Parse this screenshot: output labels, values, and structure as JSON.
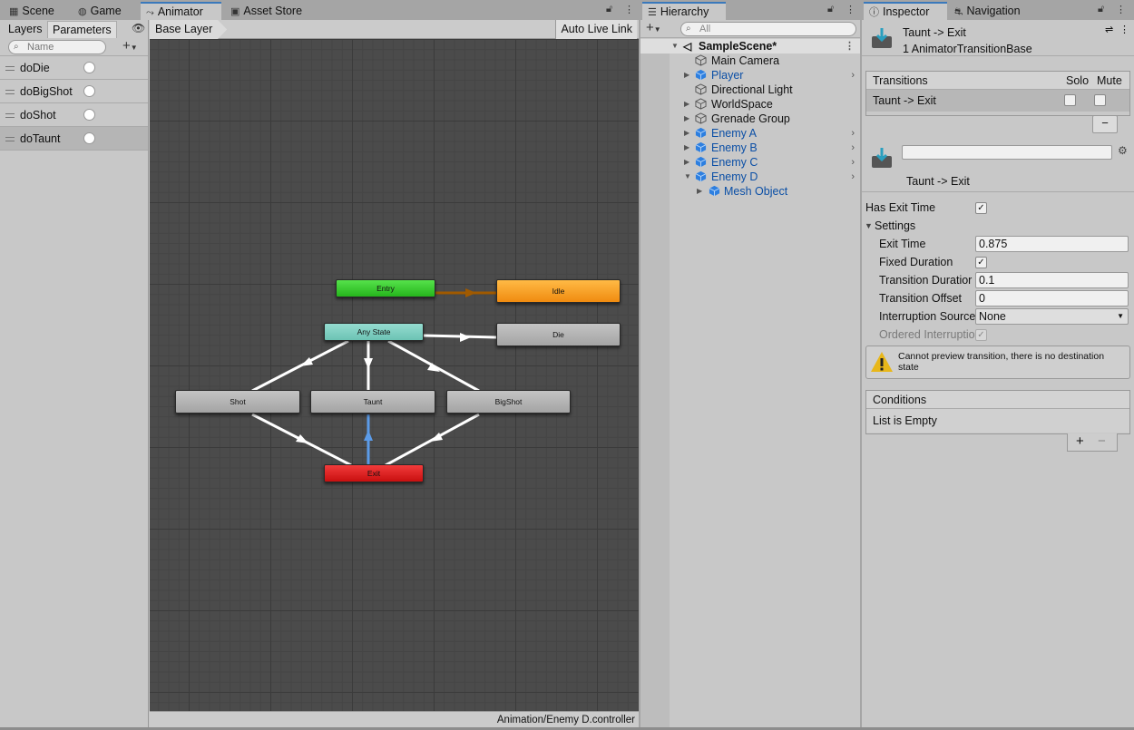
{
  "animator_panel": {
    "tabs": [
      {
        "label": "Scene",
        "icon": "grid-icon"
      },
      {
        "label": "Game",
        "icon": "gamepad-icon"
      },
      {
        "label": "Animator",
        "icon": "animator-icon"
      },
      {
        "label": "Asset Store",
        "icon": "store-icon"
      }
    ],
    "subtabs": {
      "layers": "Layers",
      "parameters": "Parameters"
    },
    "search_placeholder": "Name",
    "parameters": [
      "doDie",
      "doBigShot",
      "doShot",
      "doTaunt"
    ],
    "breadcrumb": "Base Layer",
    "auto_live_link": "Auto Live Link",
    "states": {
      "entry": "Entry",
      "idle": "Idle",
      "any_state": "Any State",
      "die": "Die",
      "shot": "Shot",
      "taunt": "Taunt",
      "bigshot": "BigShot",
      "exit": "Exit"
    },
    "footer_path": "Animation/Enemy D.controller"
  },
  "hierarchy": {
    "tab_label": "Hierarchy",
    "search_placeholder": "All",
    "scene_name": "SampleScene*",
    "items": [
      {
        "label": "Main Camera"
      },
      {
        "label": "Player"
      },
      {
        "label": "Directional Light"
      },
      {
        "label": "WorldSpace"
      },
      {
        "label": "Grenade Group"
      },
      {
        "label": "Enemy A"
      },
      {
        "label": "Enemy B"
      },
      {
        "label": "Enemy C"
      },
      {
        "label": "Enemy D"
      },
      {
        "label": "Mesh Object"
      }
    ]
  },
  "inspector": {
    "tabs": [
      {
        "label": "Inspector",
        "icon": "info-icon"
      },
      {
        "label": "Navigation",
        "icon": "navigation-icon"
      }
    ],
    "header_title": "Taunt -> Exit",
    "header_subtitle": "1 AnimatorTransitionBase",
    "transitions_header": "Transitions",
    "solo_label": "Solo",
    "mute_label": "Mute",
    "transition_item": "Taunt -> Exit",
    "name_value": "",
    "transition_title": "Taunt -> Exit",
    "has_exit_time_label": "Has Exit Time",
    "settings_label": "Settings",
    "fields": {
      "exit_time_label": "Exit Time",
      "exit_time_value": "0.875",
      "fixed_duration_label": "Fixed Duration",
      "transition_duration_label": "Transition Duratior",
      "transition_duration_value": "0.1",
      "transition_offset_label": "Transition Offset",
      "transition_offset_value": "0",
      "interruption_source_label": "Interruption Source",
      "interruption_source_value": "None",
      "ordered_interruption_label": "Ordered Interruptio"
    },
    "warning_text": "Cannot preview transition, there is no destination state",
    "conditions_header": "Conditions",
    "conditions_empty": "List is Empty",
    "plus": "+",
    "minus": "−"
  },
  "colors": {
    "accent": "#3a79bb",
    "entry": "#3bcf31",
    "idle": "#f6a128",
    "any_state": "#7fcfc1",
    "exit": "#df2222",
    "entry_arrow": "#a05a00",
    "selected_arrow": "#5b9be8",
    "blue_text": "#0b4fa6"
  }
}
